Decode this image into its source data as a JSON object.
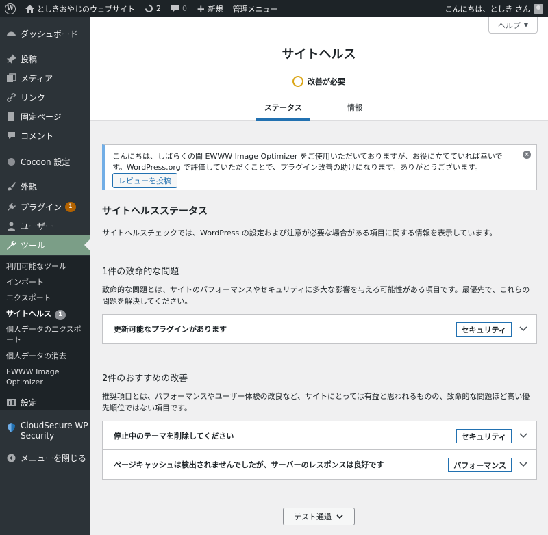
{
  "adminbar": {
    "site_name": "としきおやじのウェブサイト",
    "updates_count": "2",
    "comments_count": "0",
    "new_label": "新規",
    "admin_menu_label": "管理メニュー",
    "greeting": "こんにちは、としき さん"
  },
  "sidebar": {
    "items": [
      {
        "label": "ダッシュボード",
        "icon": "dashboard-icon"
      },
      {
        "label": "投稿",
        "icon": "pin-icon"
      },
      {
        "label": "メディア",
        "icon": "media-icon"
      },
      {
        "label": "リンク",
        "icon": "link-icon"
      },
      {
        "label": "固定ページ",
        "icon": "page-icon"
      },
      {
        "label": "コメント",
        "icon": "comment-icon"
      },
      {
        "label": "Cocoon 設定",
        "icon": "circle-icon"
      },
      {
        "label": "外観",
        "icon": "brush-icon"
      },
      {
        "label": "プラグイン",
        "icon": "plugin-icon",
        "count": "1"
      },
      {
        "label": "ユーザー",
        "icon": "user-icon"
      },
      {
        "label": "ツール",
        "icon": "wrench-icon"
      },
      {
        "label": "設定",
        "icon": "settings-icon"
      },
      {
        "label": "CloudSecure WP Security",
        "icon": "shield-icon"
      },
      {
        "label": "メニューを閉じる",
        "icon": "collapse-icon"
      }
    ],
    "submenu": [
      {
        "label": "利用可能なツール"
      },
      {
        "label": "インポート"
      },
      {
        "label": "エクスポート"
      },
      {
        "label": "サイトヘルス",
        "count": "1"
      },
      {
        "label": "個人データのエクスポート"
      },
      {
        "label": "個人データの消去"
      },
      {
        "label": "EWWW Image Optimizer"
      }
    ]
  },
  "header": {
    "help_label": "ヘルプ",
    "title": "サイトヘルス",
    "status": "改善が必要",
    "tabs": [
      "ステータス",
      "情報"
    ]
  },
  "notice": {
    "text": "こんにちは、しばらくの間 EWWW Image Optimizer をご使用いただいておりますが、お役に立てていれば幸いです。WordPress.org で評価していただくことで、プラグイン改善の助けになります。ありがとうございます。",
    "button": "レビューを投稿"
  },
  "main": {
    "section_title": "サイトヘルスステータス",
    "section_desc": "サイトヘルスチェックでは、WordPress の設定および注意が必要な場合がある項目に関する情報を表示しています。",
    "critical": {
      "title": "1件の致命的な問題",
      "desc": "致命的な問題とは、サイトのパフォーマンスやセキュリティに多大な影響を与える可能性がある項目です。最優先で、これらの問題を解決してください。",
      "items": [
        {
          "label": "更新可能なプラグインがあります",
          "badge": "セキュリティ"
        }
      ]
    },
    "recommended": {
      "title": "2件のおすすめの改善",
      "desc": "推奨項目とは、パフォーマンスやユーザー体験の改良など、サイトにとっては有益と思われるものの、致命的な問題ほど高い優先順位ではない項目です。",
      "items": [
        {
          "label": "停止中のテーマを削除してください",
          "badge": "セキュリティ"
        },
        {
          "label": "ページキャッシュは検出されませんでしたが、サーバーのレスポンスは良好です",
          "badge": "パフォーマンス"
        }
      ]
    },
    "passed_button": "テスト通過"
  }
}
